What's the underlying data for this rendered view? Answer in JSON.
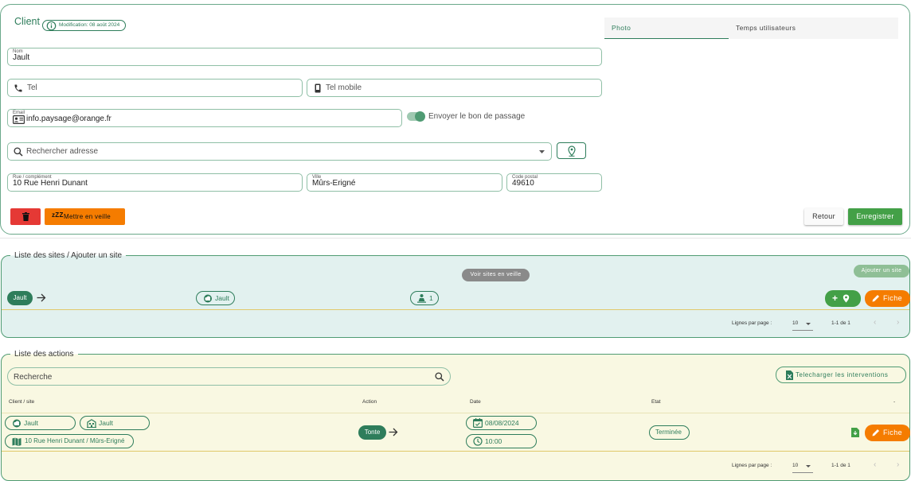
{
  "client": {
    "title": "Client",
    "modification": "Modification: 08 août 2024",
    "nom_label": "Nom",
    "nom_value": "Jault",
    "tel_placeholder": "Tel",
    "tel_mobile_placeholder": "Tel mobile",
    "email_label": "Email",
    "email_value": "info.paysage@orange.fr",
    "envoyer_label": "Envoyer le bon de passage",
    "search_address_placeholder": "Rechercher adresse",
    "rue_label": "Rue / complément",
    "rue_value": "10 Rue Henri Dunant",
    "ville_label": "Ville",
    "ville_value": "Mûrs-Erigné",
    "cp_label": "Code postal",
    "cp_value": "49610",
    "sleep_label": "Mettre en veille",
    "sleep_prefix": "zZZ",
    "retour_label": "Retour",
    "save_label": "Enregistrer"
  },
  "side_tabs": {
    "photo": "Photo",
    "temps": "Temps utilisateurs"
  },
  "sites": {
    "legend": "Liste des sites / Ajouter un site",
    "voir_veille": "Voir sites en veille",
    "ajouter_site": "Ajouter un site",
    "row": {
      "client_chip": "Jault",
      "site_chip": "Jault",
      "count_chip": "1",
      "fiche": "Fiche"
    },
    "pager": {
      "lines_label": "Lignes par page :",
      "per_page": "10",
      "range": "1-1 de 1"
    }
  },
  "actions": {
    "legend": "Liste des actions",
    "search_placeholder": "Recherche",
    "download_label": "Telecharger les interventions",
    "columns": {
      "client_site": "Client / site",
      "action": "Action",
      "date": "Date",
      "etat": "Etat",
      "extra": "-"
    },
    "row": {
      "client": "Jault",
      "site": "Jault",
      "address": "10 Rue Henri Dunant / Mûrs-Erigné",
      "action": "Tonte",
      "date": "08/08/2024",
      "time": "10:00",
      "etat": "Terminée",
      "fiche": "Fiche"
    },
    "pager": {
      "lines_label": "Lignes par page :",
      "per_page": "10",
      "range": "1-1 de 1"
    }
  },
  "colors": {
    "primary_green": "#2e7d5b",
    "button_green": "#43a047",
    "orange": "#f57c00",
    "red": "#e53935",
    "sites_bg": "#e2f1ef",
    "actions_bg": "#f9f8e2"
  }
}
